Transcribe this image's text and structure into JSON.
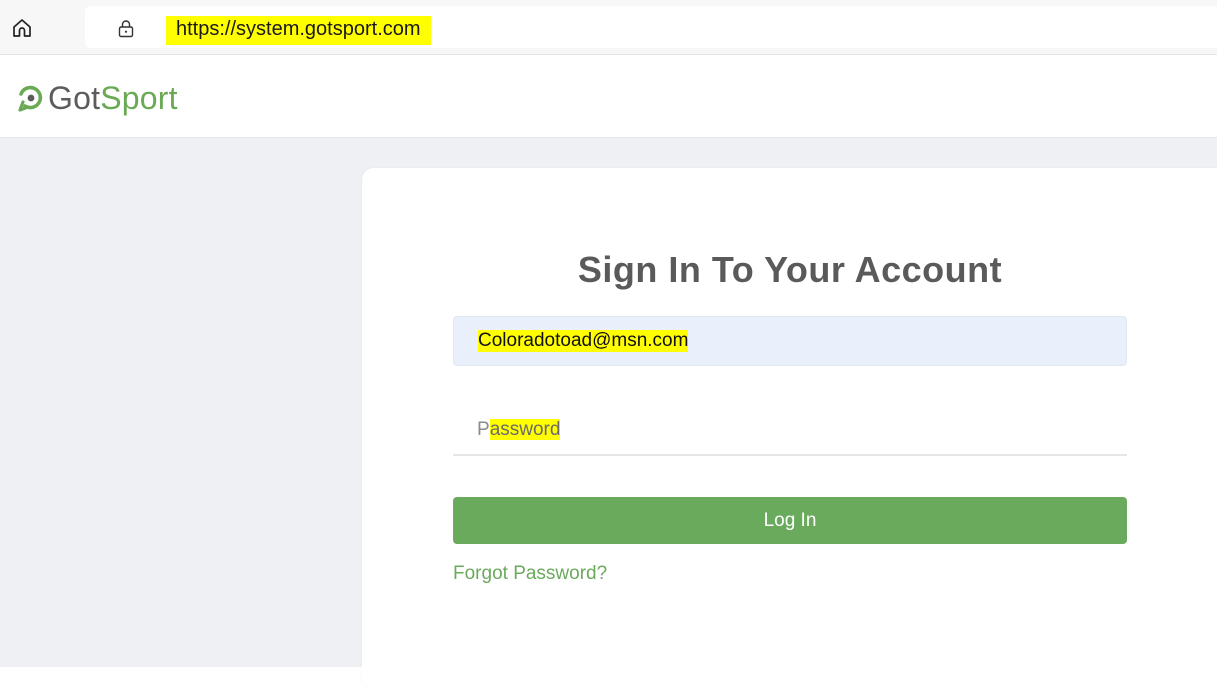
{
  "browser": {
    "url": "https://system.gotsport.com",
    "home_icon": "home-icon",
    "lock_icon": "lock-icon"
  },
  "header": {
    "logo_got": "Got",
    "logo_sport": "Sport",
    "logo_icon": "gotsport-logo-icon"
  },
  "signin": {
    "title": "Sign In To Your Account",
    "email_value": "Coloradotoad@msn.com",
    "password_placeholder_first": "P",
    "password_placeholder_rest": "assword",
    "login_label": "Log In",
    "forgot_label": "Forgot Password?"
  },
  "colors": {
    "brand_green": "#6aaa5c",
    "highlight": "#ffff00",
    "page_bg": "#eef0f4",
    "title_gray": "#5a5a5a"
  }
}
